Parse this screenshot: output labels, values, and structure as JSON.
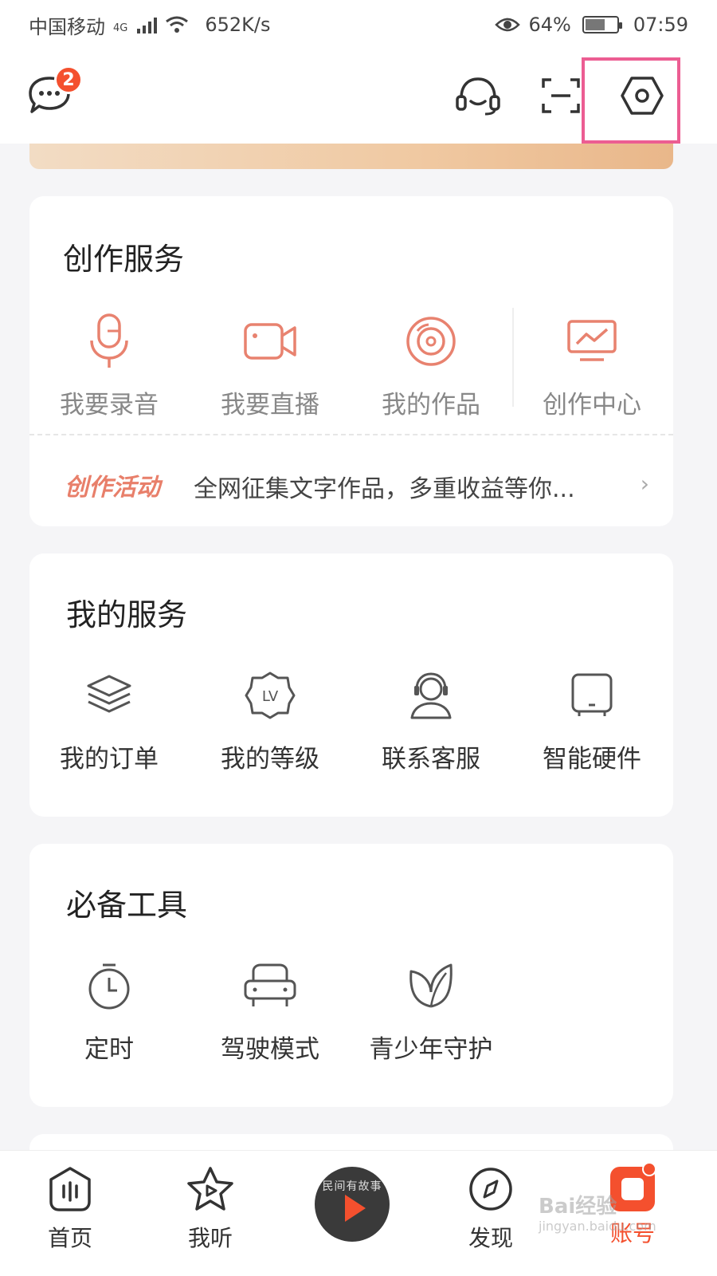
{
  "status_bar": {
    "carrier": "中国移动",
    "network": "4G",
    "speed": "652K/s",
    "battery": "64%",
    "battery_level": 0.64,
    "time": "07:59"
  },
  "header": {
    "message_badge": "2",
    "icons": [
      "message-icon",
      "headset-icon",
      "scan-icon",
      "settings-hex-icon"
    ]
  },
  "creation": {
    "title": "创作服务",
    "items": [
      {
        "label": "我要录音",
        "icon": "microphone-icon"
      },
      {
        "label": "我要直播",
        "icon": "video-camera-icon"
      },
      {
        "label": "我的作品",
        "icon": "disc-icon"
      },
      {
        "label": "创作中心",
        "icon": "monitor-chart-icon"
      }
    ],
    "activity_tag": "创作活动",
    "activity_text": "全网征集文字作品，多重收益等你..."
  },
  "services": {
    "title": "我的服务",
    "items": [
      {
        "label": "我的订单",
        "icon": "layers-icon"
      },
      {
        "label": "我的等级",
        "icon": "lv-badge-icon",
        "badge_text": "LV"
      },
      {
        "label": "联系客服",
        "icon": "customer-service-icon"
      },
      {
        "label": "智能硬件",
        "icon": "smart-device-icon"
      }
    ]
  },
  "tools": {
    "title": "必备工具",
    "items": [
      {
        "label": "定时",
        "icon": "timer-icon"
      },
      {
        "label": "驾驶模式",
        "icon": "car-seat-icon"
      },
      {
        "label": "青少年守护",
        "icon": "leaf-icon"
      }
    ]
  },
  "bottom_nav": {
    "items": [
      {
        "label": "首页",
        "icon": "home-icon"
      },
      {
        "label": "我听",
        "icon": "star-play-icon"
      },
      {
        "label": "发现",
        "icon": "compass-icon"
      },
      {
        "label": "账号",
        "icon": "account-icon",
        "active": true
      }
    ],
    "now_playing_text": "民间有故事"
  },
  "watermark": {
    "text": "Bai经验",
    "sub": "jingyan.baidu.com"
  },
  "colors": {
    "accent": "#f4502e",
    "creation_icon": "#e8826f",
    "highlight": "#ec5d92"
  }
}
